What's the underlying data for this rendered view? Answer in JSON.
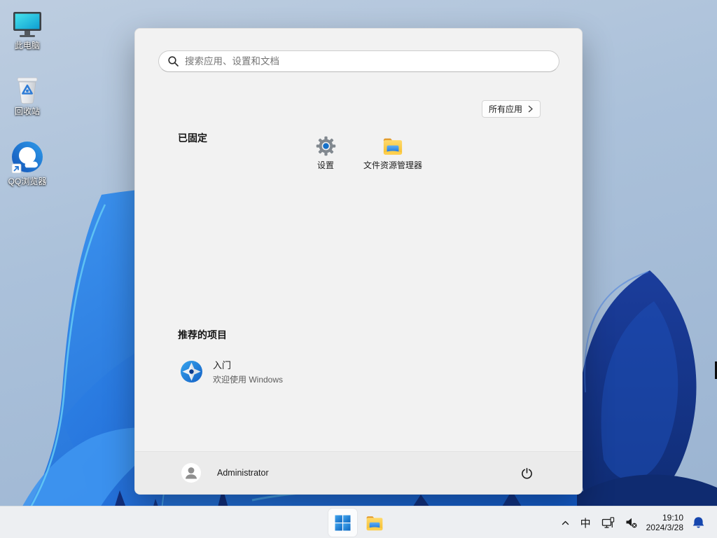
{
  "desktop": {
    "icons": [
      {
        "name": "this-pc",
        "label": "此电脑"
      },
      {
        "name": "recycle-bin",
        "label": "回收站"
      },
      {
        "name": "qq-browser",
        "label": "QQ浏览器"
      }
    ]
  },
  "start_menu": {
    "search": {
      "placeholder": "搜索应用、设置和文档"
    },
    "pinned": {
      "title": "已固定",
      "all_apps_label": "所有应用",
      "apps": [
        {
          "name": "settings",
          "label": "设置"
        },
        {
          "name": "file-explorer",
          "label": "文件资源管理器"
        }
      ]
    },
    "recommended": {
      "title": "推荐的项目",
      "items": [
        {
          "name": "get-started",
          "title": "入门",
          "subtitle": "欢迎使用 Windows"
        }
      ]
    },
    "user": {
      "name": "Administrator"
    }
  },
  "taskbar": {
    "tray": {
      "ime_label": "中",
      "time": "19:10",
      "date": "2024/3/28"
    }
  },
  "colors": {
    "accent_blue": "#1283D8",
    "bell_blue": "#1546AE",
    "folder_yellow": "#FFCE45",
    "bloom_blue": "#2F85E8",
    "bloom_navy": "#0F2C74"
  }
}
